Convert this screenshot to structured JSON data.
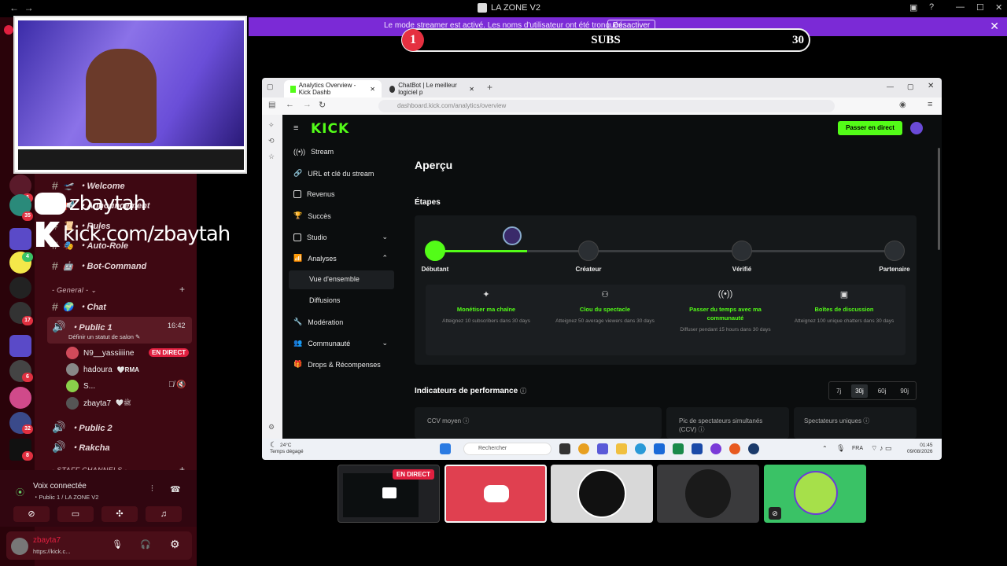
{
  "window": {
    "title": "LA ZONE V2",
    "back": "←",
    "forward": "→"
  },
  "streamer_banner": {
    "text": "Le mode streamer est activé. Les noms d'utilisateur ont été tronqués.",
    "button": "Désactiver"
  },
  "subs_goal": {
    "current": "1",
    "label": "SUBS",
    "goal": "30",
    "progress": 0.033
  },
  "overlay": {
    "discord_name": "zbaytah",
    "kick_url": "kick.com/zbaytah"
  },
  "discord": {
    "rail_badges": [
      "6",
      "35",
      "4",
      "17",
      "6",
      "32",
      "8"
    ],
    "channels": [
      {
        "emoji": "🛫",
        "name": "・Welcome"
      },
      {
        "emoji": "📢",
        "name": "・Announcement"
      },
      {
        "emoji": "📜",
        "name": "・Rules"
      },
      {
        "emoji": "🎭",
        "name": "・Auto-Role"
      },
      {
        "emoji": "🤖",
        "name": "・Bot-Command"
      }
    ],
    "category_general": "- General -",
    "chat_channel": {
      "emoji": "🌍",
      "name": "・Chat"
    },
    "voice_public1": {
      "name": "・Public 1",
      "time": "16:42",
      "status": "Définir un statut de salon"
    },
    "voice_users": [
      {
        "name": "N9__yassiiiine",
        "badge": "EN DIRECT"
      },
      {
        "name": "hadoura",
        "tag": "🤍RMA"
      },
      {
        "name": "S..."
      },
      {
        "name": "zbayta7",
        "tag": "🤍ﷺ"
      }
    ],
    "voice_public2": "・Public 2",
    "voice_rakcha": "・Rakcha",
    "category_staff": "- STAFF CHANNELS -",
    "voice_connected": {
      "title": "Voix connectée",
      "subtitle": "・Public 1 / LA ZONE V2"
    },
    "current_user": {
      "name": "zbayta7",
      "status": "https://kick.c..."
    }
  },
  "browser": {
    "tabs": [
      {
        "label": "Analytics Overview - Kick Dashb"
      },
      {
        "label": "ChatBot | Le meilleur logiciel p"
      }
    ],
    "url": "dashboard.kick.com/analytics/overview",
    "new_tab": "+"
  },
  "kick": {
    "logo": "KICK",
    "go_live": "Passer en direct",
    "sidebar": [
      {
        "label": "Stream"
      },
      {
        "label": "URL et clé du stream"
      },
      {
        "label": "Revenus"
      },
      {
        "label": "Succès"
      },
      {
        "label": "Studio"
      },
      {
        "label": "Analyses"
      },
      {
        "label": "Vue d'ensemble"
      },
      {
        "label": "Diffusions"
      },
      {
        "label": "Modération"
      },
      {
        "label": "Communauté"
      },
      {
        "label": "Drops & Récompenses"
      }
    ],
    "page_title": "Aperçu",
    "steps_title": "Étapes",
    "steps": [
      {
        "label": "Débutant"
      },
      {
        "label": "Créateur"
      },
      {
        "label": "Vérifié"
      },
      {
        "label": "Partenaire"
      }
    ],
    "step_progress": 0.2,
    "tasks": [
      {
        "title": "Monétiser ma chaîne",
        "desc": "Atteignez 10 subscribers dans 30 days"
      },
      {
        "title": "Clou du spectacle",
        "desc": "Atteignez 50 average viewers dans 30 days"
      },
      {
        "title": "Passer du temps avec ma communauté",
        "desc": "Diffuser pendant 15 hours dans 30 days"
      },
      {
        "title": "Boîtes de discussion",
        "desc": "Atteignez 100 unique chatters dans 30 days"
      }
    ],
    "perf_title": "Indicateurs de performance",
    "ranges": [
      "7j",
      "30j",
      "60j",
      "90j"
    ],
    "range_selected": "30j",
    "metrics": [
      {
        "label": "CCV moyen"
      },
      {
        "label": "Pic de spectateurs simultanés (CCV)"
      },
      {
        "label": "Spectateurs uniques"
      }
    ]
  },
  "taskbar": {
    "temp": "24°C",
    "weather": "Temps dégagé",
    "search": "Rechercher",
    "lang": "FRA",
    "time": "01:45",
    "date": "09/08/2026"
  },
  "participants": {
    "live_badge": "EN DIRECT"
  },
  "colors": {
    "kick_green": "#53fc18",
    "discord_bg": "#3a0610",
    "banner": "#7b2ad6",
    "live_red": "#e02040"
  }
}
